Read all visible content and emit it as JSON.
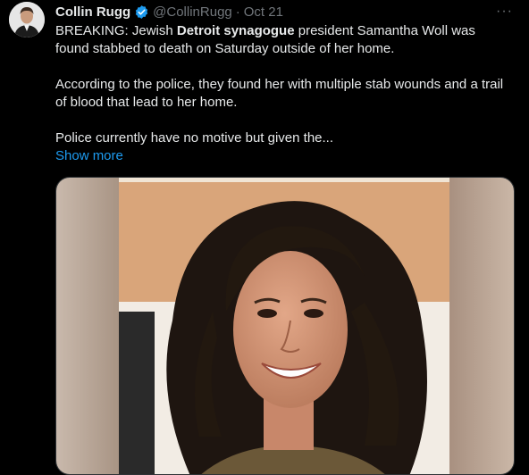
{
  "author": {
    "display_name": "Collin Rugg",
    "handle": "@CollinRugg",
    "date": "Oct 21",
    "separator": "·"
  },
  "icons": {
    "verified": "verified-badge-icon",
    "more": "more-options-icon"
  },
  "more_label": "···",
  "tweet": {
    "p1_prefix": "BREAKING: Jewish ",
    "p1_bold": "Detroit synagogue",
    "p1_suffix": " president Samantha Woll was found stabbed to death on Saturday outside of her home.",
    "p2": "According to the police, they found her with multiple stab wounds and a trail of blood that lead to her home.",
    "p3": "Police currently have no motive but given the...",
    "show_more": "Show more"
  },
  "colors": {
    "background": "#000000",
    "text": "#e7e9ea",
    "secondary": "#71767b",
    "link": "#1d9bf0",
    "verified": "#1d9bf0"
  }
}
